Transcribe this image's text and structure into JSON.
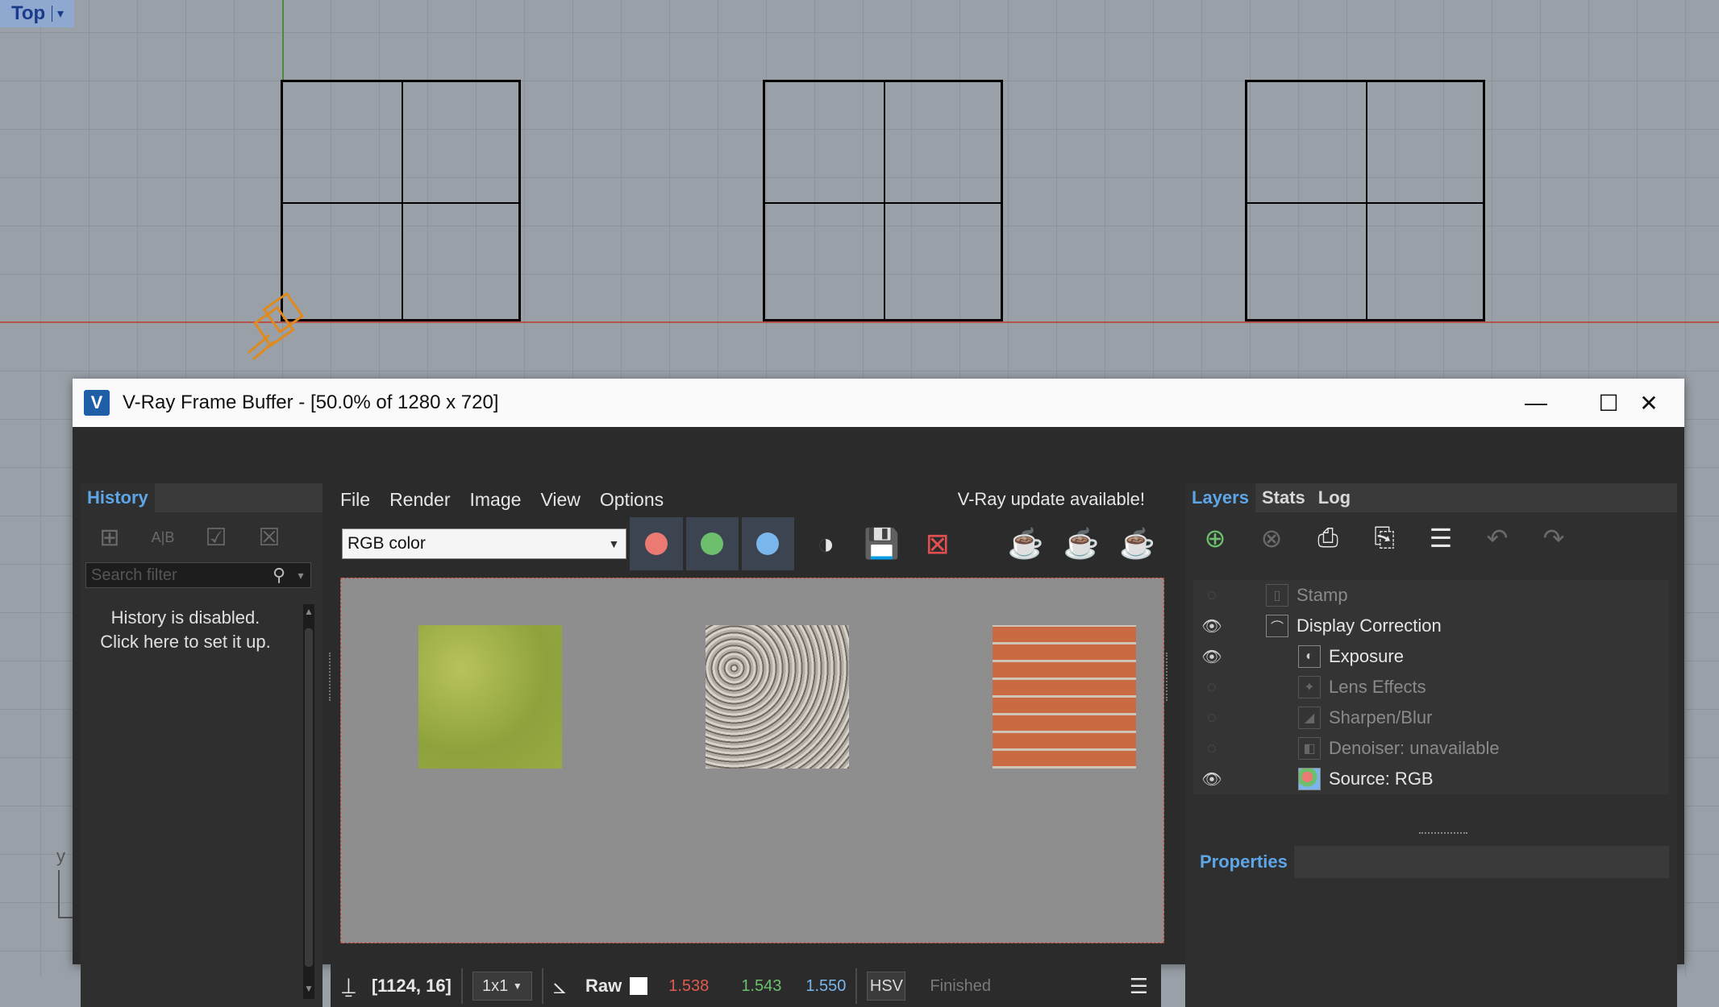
{
  "viewport": {
    "label": "Top",
    "dropdown_glyph": "▾",
    "y_axis_label": "y"
  },
  "window": {
    "title": "V-Ray Frame Buffer - [50.0% of 1280 x 720]",
    "logo": "V",
    "controls": {
      "minimize": "—",
      "maximize": "☐",
      "close": "✕"
    }
  },
  "history": {
    "tab": "History",
    "search_placeholder": "Search filter",
    "message_line1": "History is disabled.",
    "message_line2": "Click here to set it up."
  },
  "menu": {
    "items": [
      "File",
      "Render",
      "Image",
      "View",
      "Options"
    ],
    "update_notice": "V-Ray update available!"
  },
  "toolbar": {
    "channel_select": "RGB color",
    "channel_colors": {
      "red": "#ea7a72",
      "green": "#6dbf6d",
      "blue": "#7ab6ec"
    }
  },
  "render": {
    "swatches": [
      {
        "name": "grass",
        "color": "#9fb04a"
      },
      {
        "name": "gravel",
        "color": "#b9b3a9"
      },
      {
        "name": "brick",
        "color": "#c96a43"
      }
    ]
  },
  "status": {
    "coords": "[1124, 16]",
    "zoom": "1x1",
    "mode": "Raw",
    "r": "1.538",
    "g": "1.543",
    "b": "1.550",
    "color_space": "HSV",
    "state": "Finished"
  },
  "right": {
    "tabs": [
      "Layers",
      "Stats",
      "Log"
    ],
    "layers": [
      {
        "label": "Stamp",
        "visible": false,
        "indent": 0,
        "icon": "▯"
      },
      {
        "label": "Display Correction",
        "visible": true,
        "indent": 0,
        "icon": "⌒"
      },
      {
        "label": "Exposure",
        "visible": true,
        "indent": 1,
        "icon": "◐"
      },
      {
        "label": "Lens Effects",
        "visible": false,
        "indent": 1,
        "icon": "✦"
      },
      {
        "label": "Sharpen/Blur",
        "visible": false,
        "indent": 1,
        "icon": "◢"
      },
      {
        "label": "Denoiser: unavailable",
        "visible": false,
        "indent": 1,
        "icon": "◧"
      },
      {
        "label": "Source: RGB",
        "visible": true,
        "indent": 1,
        "icon": "●"
      }
    ],
    "properties_tab": "Properties"
  }
}
